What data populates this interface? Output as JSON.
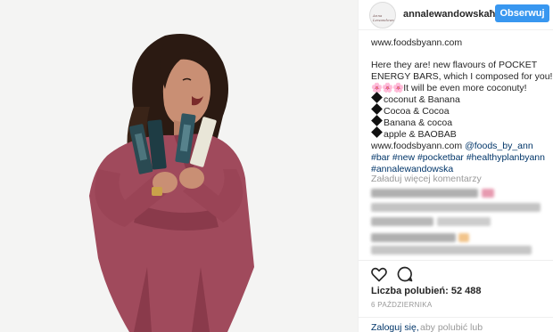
{
  "post": {
    "photo_icon": "woman-holding-energy-bars-photo"
  },
  "header": {
    "avatar_text": "Anna Lewandowska",
    "username": "annalewandowskaħ",
    "follow_label": "Obserwuj"
  },
  "caption": {
    "website": "www.foodsbyann.com",
    "line1": "Here they are! new flavours of POCKET",
    "line2": "ENERGY BARS, which I composed for you!",
    "line3_emoji": "🌸🌸🌸",
    "line3": "It will be even more coconuty!",
    "item1": "coconut & Banana",
    "item2": "Cocoa & Cocoa",
    "item3": "Banana & cocoa",
    "item4": "apple & BAOBAB",
    "website2": "www.foodsbyann.com",
    "mention": "@foods_by_ann",
    "hashtags_line1": "#bar #new #pocketbar #healthyplanbyann",
    "hashtags_line2": "#annalewandowska"
  },
  "comments": {
    "load_more": "Załaduj więcej komentarzy"
  },
  "actions": {
    "like_icon": "heart-outline-icon",
    "comment_icon": "comment-bubble-icon",
    "likes_label": "Liczba polubień: 52 488",
    "date": "6 PAŹDZIERNIKA"
  },
  "footer": {
    "login": "Zaloguj się,",
    "rest": "aby polubić lub"
  },
  "colors": {
    "accent": "#3897f0",
    "link": "#003569",
    "muted": "#999999"
  }
}
